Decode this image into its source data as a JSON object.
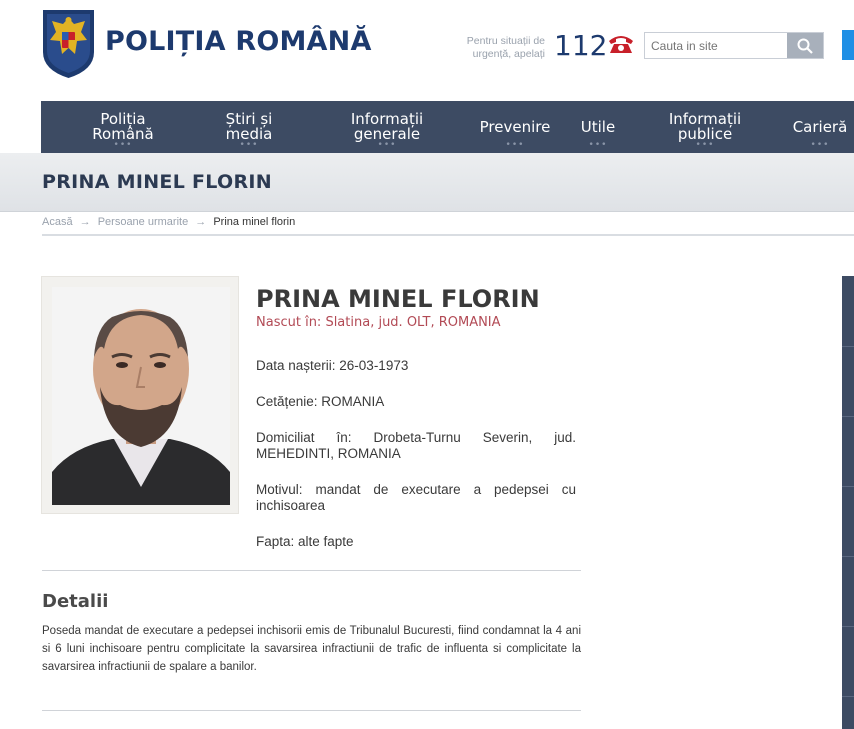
{
  "header": {
    "brand": "POLIȚIA ROMÂNĂ",
    "emergency_text_line1": "Pentru situații de",
    "emergency_text_line2": "urgență, apelați",
    "emergency_number": "112",
    "search_placeholder": "Cauta in site",
    "phone_icon": "phone-icon",
    "search_icon": "search-icon"
  },
  "nav": {
    "items": [
      {
        "line1": "Poliția",
        "line2": "Română"
      },
      {
        "line1": "Știri și",
        "line2": "media"
      },
      {
        "line1": "Informații",
        "line2": "generale"
      },
      {
        "line1": "Prevenire",
        "line2": ""
      },
      {
        "line1": "Utile",
        "line2": ""
      },
      {
        "line1": "Informații",
        "line2": "publice"
      },
      {
        "line1": "Carieră",
        "line2": ""
      }
    ],
    "dots": "•••"
  },
  "page": {
    "title": "PRINA MINEL FLORIN"
  },
  "breadcrumb": {
    "home": "Acasă",
    "sep": "→",
    "section": "Persoane urmarite",
    "current": "Prina minel florin"
  },
  "person": {
    "name": "PRINA MINEL FLORIN",
    "birthplace": "Nascut în: Slatina, jud. OLT, ROMANIA",
    "birth_date": "Data nașterii: 26-03-1973",
    "citizenship": "Cetățenie: ROMANIA",
    "residence": "Domiciliat în: Drobeta-Turnu Severin, jud. MEHEDINTI, ROMANIA",
    "reason": "Motivul: mandat de executare a pedepsei cu inchisoarea",
    "deed": "Fapta: alte fapte"
  },
  "details": {
    "title": "Detalii",
    "text": "Poseda mandat de executare a pedepsei inchisorii emis de Tribunalul Bucuresti, fiind condamnat la 4 ani si 6 luni inchisoare pentru complicitate la savarsirea infractiunii de trafic de influenta si complicitate la savarsirea infractiunii de spalare a banilor."
  },
  "colors": {
    "nav_bg": "#3d4b63",
    "brand": "#1d3a6e",
    "accent_red": "#c8202a",
    "birthplace": "#b24a55"
  }
}
